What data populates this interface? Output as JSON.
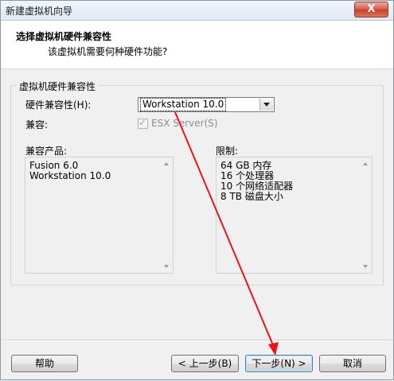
{
  "window": {
    "title": "新建虚拟机向导",
    "close_label": "X"
  },
  "header": {
    "title": "选择虚拟机硬件兼容性",
    "subtitle": "该虚拟机需要何种硬件功能?"
  },
  "group": {
    "label": "虚拟机硬件兼容性",
    "hw_compat_label": "硬件兼容性(H):",
    "hw_compat_value": "Workstation 10.0",
    "compat_label": "兼容:",
    "esx_checkbox_label": "ESX Server(S)",
    "esx_checked": true,
    "esx_enabled": false,
    "products_label": "兼容产品:",
    "products": [
      "Fusion 6.0",
      "Workstation 10.0"
    ],
    "limits_label": "限制:",
    "limits": [
      "64 GB 内存",
      "16 个处理器",
      "10 个网络适配器",
      "8 TB 磁盘大小"
    ]
  },
  "buttons": {
    "help": "帮助",
    "back": "< 上一步(B)",
    "next": "下一步(N) >",
    "cancel": "取消"
  },
  "annotation_color": "#e8151b"
}
